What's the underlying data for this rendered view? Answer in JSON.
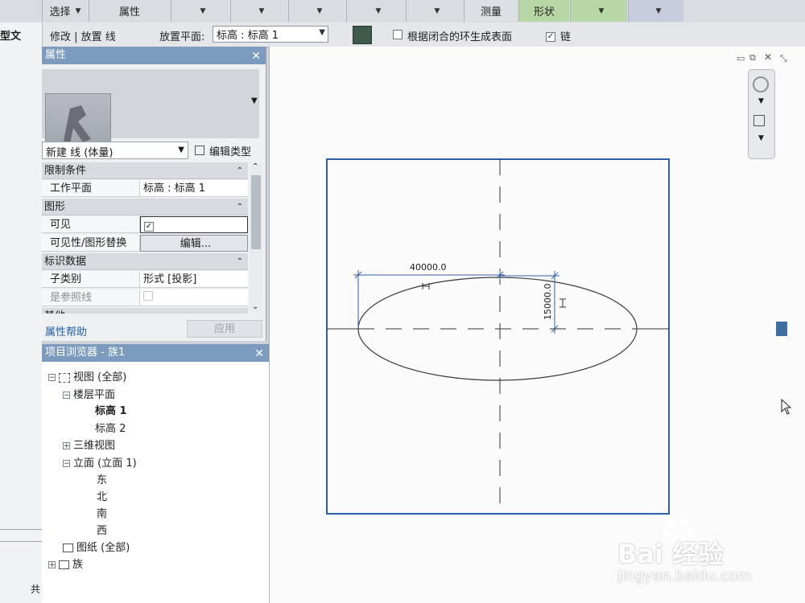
{
  "ribbon": {
    "select_label": "选择",
    "properties_label": "属性",
    "measure_label": "测量",
    "form_label": "形状"
  },
  "optbar": {
    "modify_label": "修改 | 放置 线",
    "workplane_label": "放置平面:",
    "workplane_value": "标高 : 标高 1",
    "closed_loop_label": "根据闭合的环生成表面",
    "chain_label": "链",
    "chain_checked": true
  },
  "left_strip": {
    "text_top": "型文",
    "text_bottom": "共"
  },
  "properties": {
    "title": "属性",
    "type_name": "新建 线 (体量)",
    "edit_type": "编辑类型",
    "groups": {
      "constraints": "限制条件",
      "graphics": "图形",
      "identity": "标识数据",
      "other": "其他"
    },
    "rows": {
      "workplane_key": "工作平面",
      "workplane_val": "标高 : 标高 1",
      "visible_key": "可见",
      "visibility_key": "可见性/图形替换",
      "visibility_btn": "编辑...",
      "subcategory_key": "子类别",
      "subcategory_val": "形式 [投影]",
      "isref_key": "是参照线"
    },
    "help_link": "属性帮助",
    "apply_btn": "应用"
  },
  "browser": {
    "title": "项目浏览器 - 族1",
    "nodes": {
      "views": "视图 (全部)",
      "floorplans": "楼层平面",
      "level1": "标高 1",
      "level2": "标高 2",
      "views3d": "三维视图",
      "elevations": "立面 (立面 1)",
      "east": "东",
      "north": "北",
      "south": "南",
      "west": "西",
      "sheets": "图纸 (全部)",
      "families": "族"
    }
  },
  "drawing": {
    "dim_horizontal": "40000.0",
    "dim_vertical": "15000.0"
  },
  "watermark": {
    "brand": "Bai 经验",
    "url": "jingyan.baidu.com"
  }
}
